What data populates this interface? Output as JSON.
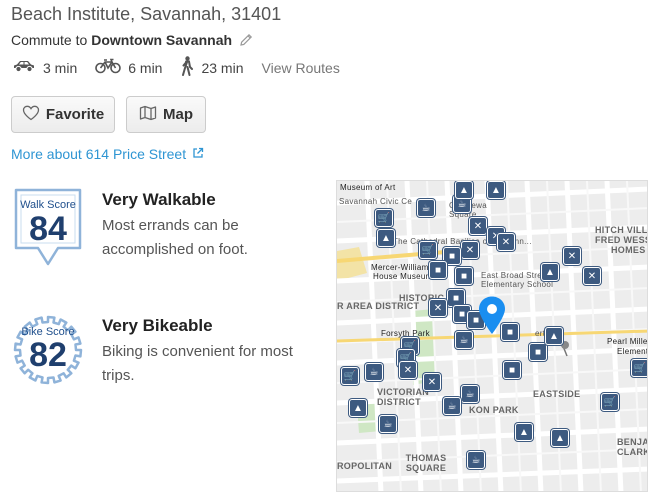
{
  "location": {
    "title": "Beach Institute, Savannah, 31401"
  },
  "commute": {
    "prefix": "Commute to",
    "destination": "Downtown Savannah",
    "edit_icon": "pencil-icon"
  },
  "modes": [
    {
      "icon": "car-icon",
      "time": "3 min"
    },
    {
      "icon": "bike-icon",
      "time": "6 min"
    },
    {
      "icon": "walk-icon",
      "time": "23 min"
    }
  ],
  "view_routes": "View Routes",
  "buttons": {
    "favorite": "Favorite",
    "map": "Map"
  },
  "more_link": "More about 614 Price Street",
  "walk_score": {
    "badge_label": "Walk Score",
    "value": "84",
    "title": "Very Walkable",
    "description": "Most errands can be accomplished on foot."
  },
  "bike_score": {
    "badge_label": "Bike Score",
    "value": "82",
    "title": "Very Bikeable",
    "description": "Biking is convenient for most trips."
  },
  "map": {
    "labels": {
      "museum": "Museum of Art",
      "civic": "Savannah Civic Ce",
      "chippewa": "Chippewa Square",
      "cathedral": "The Cathedral Basilica of St. John...",
      "mercer1": "Mercer-Williams",
      "mercer2": "House Museum",
      "eastbroad1": "East Broad Street",
      "eastbroad2": "Elementary School",
      "historic": "HISTORIC",
      "area": "R AREA DISTRICT",
      "forsyth": "Forsyth Park",
      "victorian": "VICTORIAN DISTRICT",
      "eastside": "EASTSIDE",
      "thomas": "THOMAS SQUARE",
      "metropolitan": "ROPOLITAN",
      "hitch1": "HITCH VILLA",
      "hitch2": "FRED WESSE",
      "hitch3": "HOMES",
      "milledge1": "Pearl Milledge",
      "milledge2": "Elementa",
      "benja1": "BENJA",
      "benja2": "CLARK",
      "bert": "ert Mid",
      "parkave": "KON PARK"
    },
    "pin_color": "#1a8ef0",
    "poi_color": "#3d5a80"
  },
  "colors": {
    "link": "#2e95d3",
    "badge_blue": "#1f3f6e"
  }
}
